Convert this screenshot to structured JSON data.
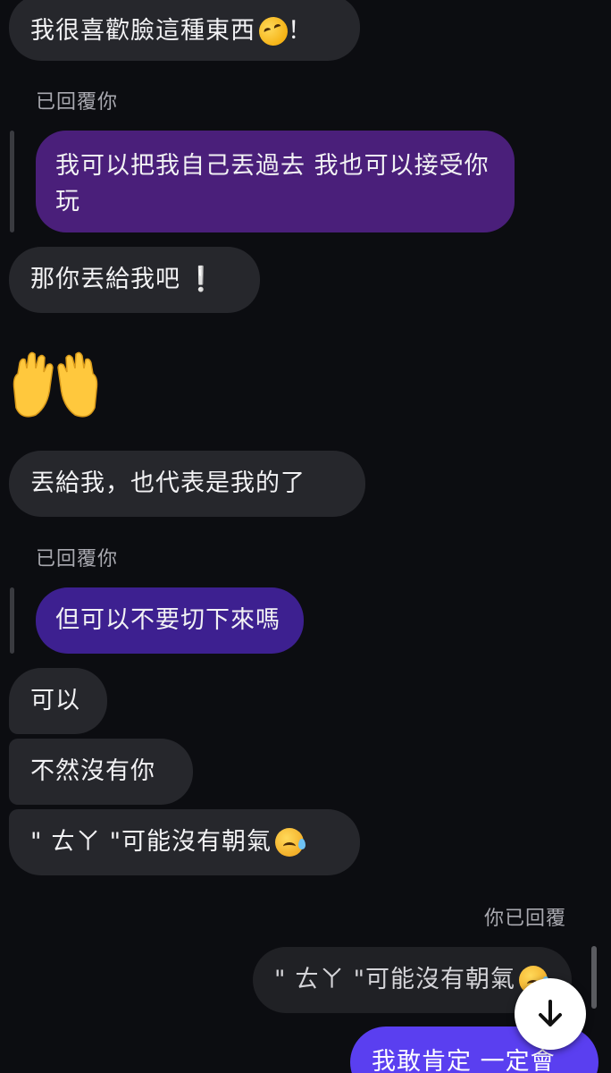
{
  "messages": {
    "m1": {
      "text": "我很喜歡臉這種東西",
      "suffix": "！",
      "emoji": "rolling-on-floor-laughing-icon"
    },
    "reply_label_1": "已回覆你",
    "quoted_1": "我可以把我自己丟過去 我也可以接受你玩",
    "m2": {
      "text": "那你丟給我吧",
      "suffix": "❕"
    },
    "m3": {
      "emoji": "palms-up-together-icon"
    },
    "m4": {
      "text": "丟給我，也代表是我的了"
    },
    "reply_label_2": "已回覆你",
    "quoted_2": "但可以不要切下來嗎",
    "m5": {
      "text": "可以"
    },
    "m6": {
      "text": "不然沒有你"
    },
    "m7": {
      "text": "\" ㄊㄚ \"可能沒有朝氣",
      "emoji": "sad-relieved-face-icon"
    },
    "reply_label_3": "你已回覆",
    "quoted_3": {
      "text": "\" ㄊㄚ \"可能沒有朝氣",
      "emoji": "sad-relieved-face-icon"
    },
    "m8": {
      "text": "我敢肯定 一定會"
    }
  },
  "controls": {
    "scroll_down_icon": "arrow-down-icon"
  },
  "colors": {
    "background": "#0c0d11",
    "incoming_bubble": "#26272c",
    "quoted_purple": "#4a1f7a",
    "quoted_indigo": "#3d2090",
    "outgoing": "#5a3ff0"
  }
}
